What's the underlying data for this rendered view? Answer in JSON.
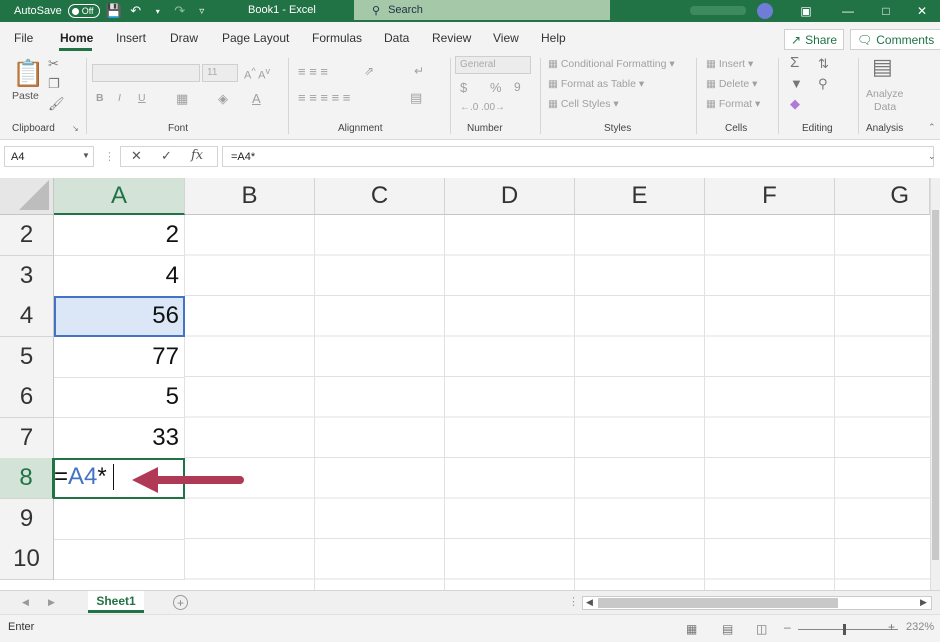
{
  "titlebar": {
    "autosave_label": "AutoSave",
    "autosave_state": "Off",
    "title": "Book1 - Excel",
    "search_placeholder": "Search",
    "accent": "#217346"
  },
  "ribbon_tabs": [
    "File",
    "Home",
    "Insert",
    "Draw",
    "Page Layout",
    "Formulas",
    "Data",
    "Review",
    "View",
    "Help"
  ],
  "active_tab": "Home",
  "share_label": "Share",
  "comments_label": "Comments",
  "ribbon": {
    "groups": [
      "Clipboard",
      "Font",
      "Alignment",
      "Number",
      "Styles",
      "Cells",
      "Editing",
      "Analysis"
    ],
    "paste_label": "Paste",
    "number_format": "General",
    "styles": [
      "Conditional Formatting",
      "Format as Table",
      "Cell Styles"
    ],
    "cells": [
      "Insert",
      "Delete",
      "Format"
    ],
    "analyze": [
      "Analyze",
      "Data"
    ]
  },
  "formula_bar": {
    "name_box": "A4",
    "formula": "=A4*"
  },
  "columns": [
    "A",
    "B",
    "C",
    "D",
    "E",
    "F",
    "G"
  ],
  "selected_column": "A",
  "rows": [
    {
      "num": "2",
      "a": "2"
    },
    {
      "num": "3",
      "a": "4"
    },
    {
      "num": "4",
      "a": "56"
    },
    {
      "num": "5",
      "a": "77"
    },
    {
      "num": "6",
      "a": "5"
    },
    {
      "num": "7",
      "a": "33"
    },
    {
      "num": "8",
      "a": ""
    },
    {
      "num": "9",
      "a": ""
    },
    {
      "num": "10",
      "a": ""
    }
  ],
  "editing_cell": {
    "eq": "=",
    "ref": "A4",
    "op": "*"
  },
  "sheet_tab": "Sheet1",
  "status": {
    "mode": "Enter",
    "zoom": "232%"
  },
  "colors": {
    "excel_green": "#217346",
    "reference_blue": "#4472c4",
    "arrow": "#b03a55"
  }
}
